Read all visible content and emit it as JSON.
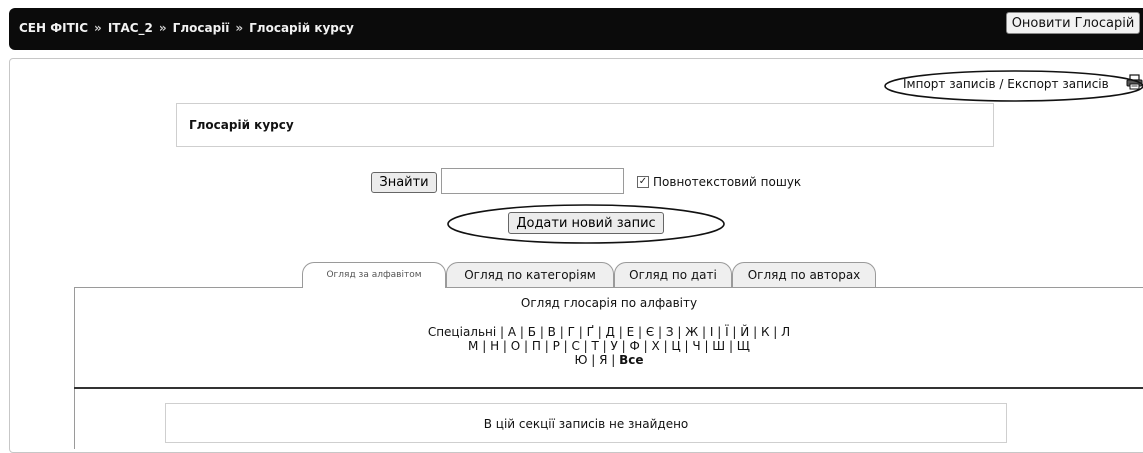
{
  "breadcrumb": {
    "items": [
      "СЕН ФІТІС",
      "ІТАС_2",
      "Глосарії",
      "Глосарій курсу"
    ],
    "separator": "»"
  },
  "header": {
    "update_button": "Оновити Глосарій"
  },
  "import_export": {
    "import_label": "Імпорт записів",
    "separator": "/",
    "export_label": "Експорт записів"
  },
  "glossary": {
    "title": "Глосарій курсу"
  },
  "search": {
    "button_label": "Знайти",
    "input_value": "",
    "fulltext_checked": true,
    "fulltext_label": "Повнотекстовий пошук"
  },
  "add_entry_button": "Додати новий запис",
  "tabs": [
    {
      "label": "Огляд за алфавітом",
      "active": true
    },
    {
      "label": "Огляд по категоріям",
      "active": false
    },
    {
      "label": "Огляд по даті",
      "active": false
    },
    {
      "label": "Огляд по авторах",
      "active": false
    }
  ],
  "browse": {
    "heading": "Огляд глосарія по алфавіту",
    "line1": "Спеціальні | А | Б | В | Г | Ґ | Д | Е | Є | З | Ж | І | Ї | Й | К | Л",
    "line2": "М | Н | О | П | Р | С | Т | У | Ф | Х | Ц | Ч | Ш | Щ",
    "line3_prefix": "Ю | Я | ",
    "line3_all": "Все"
  },
  "empty_message": "В цій секції записів не знайдено"
}
